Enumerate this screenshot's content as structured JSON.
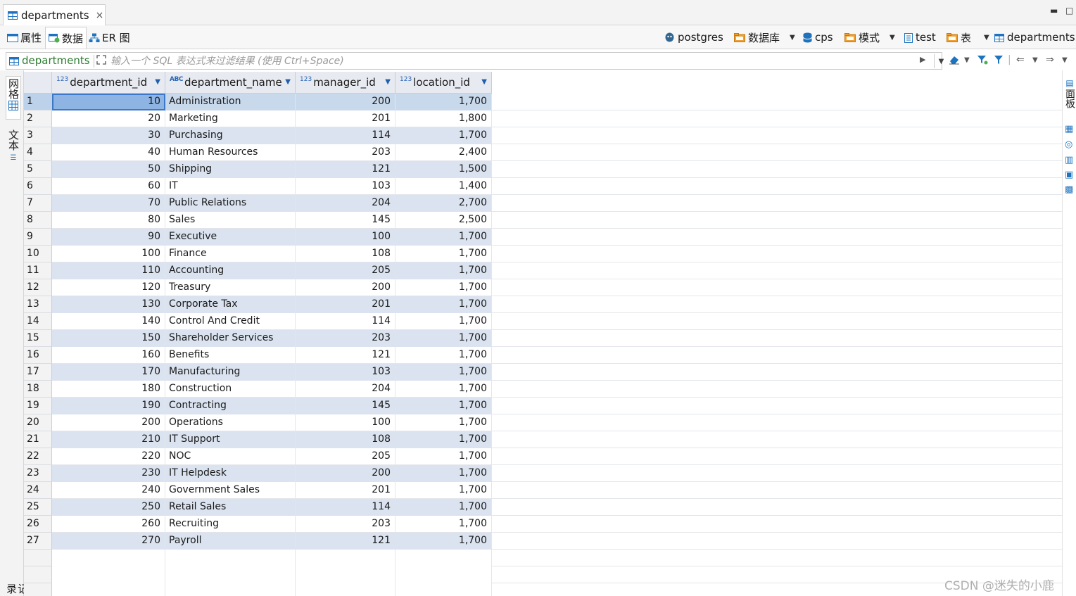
{
  "editor_tab": {
    "title": "departments",
    "close": "×"
  },
  "window_controls": {
    "minimize": "▬",
    "maximize": "□"
  },
  "subtabs": [
    {
      "label": "属性"
    },
    {
      "label": "数据"
    },
    {
      "label": "ER 图"
    }
  ],
  "breadcrumb": {
    "connection": "postgres",
    "database_label": "数据库",
    "database": "cps",
    "schema_label": "模式",
    "schema": "test",
    "table_label": "表",
    "table": "departments"
  },
  "filter": {
    "table": "departments",
    "placeholder": "输入一个 SQL 表达式来过滤结果 (使用 Ctrl+Space)"
  },
  "left_tabs": {
    "grid": "网格",
    "text": "文本",
    "bottom": "记录"
  },
  "right_tabs": {
    "panels": "面板"
  },
  "columns": [
    {
      "type": "123",
      "name": "department_id"
    },
    {
      "type": "ABC",
      "name": "department_name"
    },
    {
      "type": "123",
      "name": "manager_id"
    },
    {
      "type": "123",
      "name": "location_id"
    }
  ],
  "rows": [
    [
      "1",
      "10",
      "Administration",
      "200",
      "1,700"
    ],
    [
      "2",
      "20",
      "Marketing",
      "201",
      "1,800"
    ],
    [
      "3",
      "30",
      "Purchasing",
      "114",
      "1,700"
    ],
    [
      "4",
      "40",
      "Human Resources",
      "203",
      "2,400"
    ],
    [
      "5",
      "50",
      "Shipping",
      "121",
      "1,500"
    ],
    [
      "6",
      "60",
      "IT",
      "103",
      "1,400"
    ],
    [
      "7",
      "70",
      "Public Relations",
      "204",
      "2,700"
    ],
    [
      "8",
      "80",
      "Sales",
      "145",
      "2,500"
    ],
    [
      "9",
      "90",
      "Executive",
      "100",
      "1,700"
    ],
    [
      "10",
      "100",
      "Finance",
      "108",
      "1,700"
    ],
    [
      "11",
      "110",
      "Accounting",
      "205",
      "1,700"
    ],
    [
      "12",
      "120",
      "Treasury",
      "200",
      "1,700"
    ],
    [
      "13",
      "130",
      "Corporate Tax",
      "201",
      "1,700"
    ],
    [
      "14",
      "140",
      "Control And Credit",
      "114",
      "1,700"
    ],
    [
      "15",
      "150",
      "Shareholder Services",
      "203",
      "1,700"
    ],
    [
      "16",
      "160",
      "Benefits",
      "121",
      "1,700"
    ],
    [
      "17",
      "170",
      "Manufacturing",
      "103",
      "1,700"
    ],
    [
      "18",
      "180",
      "Construction",
      "204",
      "1,700"
    ],
    [
      "19",
      "190",
      "Contracting",
      "145",
      "1,700"
    ],
    [
      "20",
      "200",
      "Operations",
      "100",
      "1,700"
    ],
    [
      "21",
      "210",
      "IT Support",
      "108",
      "1,700"
    ],
    [
      "22",
      "220",
      "NOC",
      "205",
      "1,700"
    ],
    [
      "23",
      "230",
      "IT Helpdesk",
      "200",
      "1,700"
    ],
    [
      "24",
      "240",
      "Government Sales",
      "201",
      "1,700"
    ],
    [
      "25",
      "250",
      "Retail Sales",
      "114",
      "1,700"
    ],
    [
      "26",
      "260",
      "Recruiting",
      "203",
      "1,700"
    ],
    [
      "27",
      "270",
      "Payroll",
      "121",
      "1,700"
    ]
  ],
  "watermark": "CSDN @迷失的小鹿",
  "colors": {
    "accent": "#1e73be",
    "row_stripe": "#dae3ef",
    "selected_cell": "#8db4e2",
    "header": "#e7eaf0"
  }
}
